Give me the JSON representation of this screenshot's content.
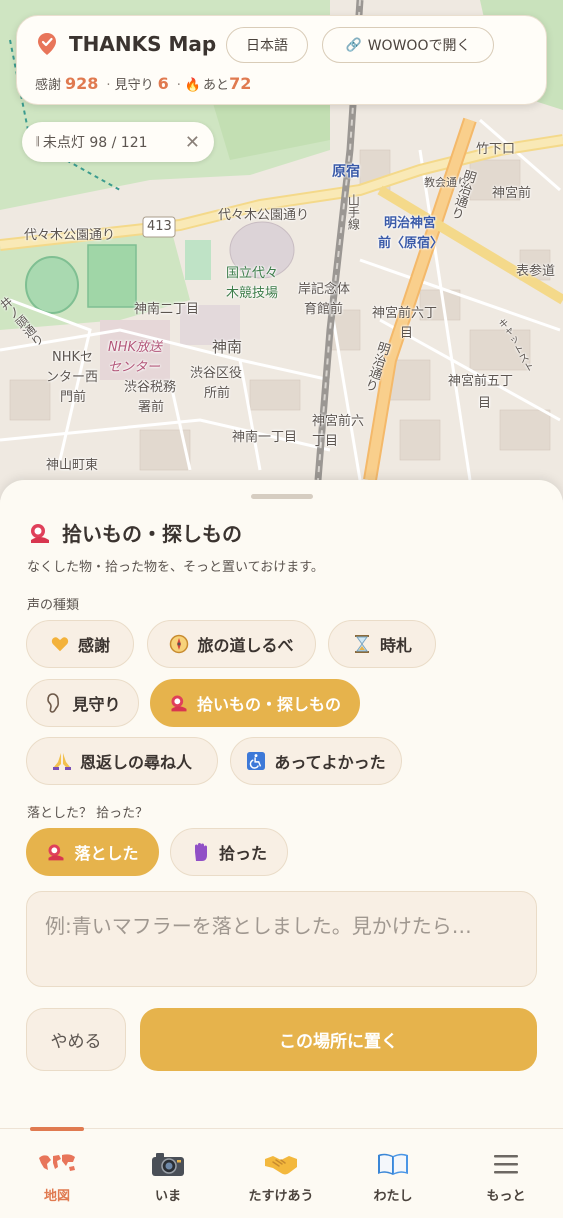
{
  "header": {
    "app_title": "THANKS Map",
    "lang_button": "日本語",
    "wowoo_button": "WOWOOで開く",
    "stats": {
      "thanks_label": "感謝",
      "thanks_count": "928",
      "watch_label": "見守り",
      "watch_count": "6",
      "remaining_label": "あと",
      "remaining_count": "72"
    }
  },
  "filter_chip": {
    "label": "未点灯 98 / 121"
  },
  "map": {
    "road_number": "413",
    "labels": {
      "yoyogi_park_road_1": "代々木公園通り",
      "yoyogi_park_road_2": "代々木公園通り",
      "harajuku": "原宿",
      "takeshita": "竹下口",
      "jingumae": "神宮前",
      "meiji_jingu_mae_1": "明治神宮",
      "meiji_jingu_mae_2": "前〈原宿〉",
      "kyokai_dori": "教会通り",
      "meiji_dori": "明治通り",
      "meiji_dori_2": "明治通り",
      "omotesando": "表参道",
      "stadium_1": "国立代々",
      "stadium_2": "木競技場",
      "kishi_1": "岸記念体",
      "kishi_2": "育館前",
      "jinnan_2": "神南二丁目",
      "jingumae_6_a": "神宮前六丁",
      "jingumae_6_b": "目",
      "jinnan": "神南",
      "nhk_center_1": "NHK放送",
      "nhk_center_2": "センター",
      "nhk_west_1": "NHKセ",
      "nhk_west_2": "ンター西",
      "nhk_west_3": "門前",
      "shibuya_tax_1": "渋谷税務",
      "shibuya_tax_2": "署前",
      "shibuya_ward_1": "渋谷区役",
      "shibuya_ward_2": "所前",
      "jingumae_5_a": "神宮前五丁",
      "jingumae_5_b": "目",
      "jingumae_6_c": "神宮前六",
      "jingumae_6_d": "丁目",
      "jinnan_1": "神南一丁目",
      "kamiyamacho_higashi": "神山町東",
      "inokashira": "井ノ頭通り",
      "yamanote": "山手線",
      "cat_street": "キャットスト"
    }
  },
  "sheet": {
    "title": "拾いもの・探しもの",
    "subtitle": "なくした物・拾った物を、そっと置いておけます。",
    "type_label": "声の種類",
    "types": [
      {
        "label": "感謝",
        "icon": "yellow-heart-icon",
        "selected": false
      },
      {
        "label": "旅の道しるべ",
        "icon": "compass-icon",
        "selected": false
      },
      {
        "label": "時札",
        "icon": "hourglass-icon",
        "selected": false
      },
      {
        "label": "見守り",
        "icon": "ear-icon",
        "selected": false
      },
      {
        "label": "拾いもの・探しもの",
        "icon": "lost-found-icon",
        "selected": true
      },
      {
        "label": "恩返しの尋ね人",
        "icon": "praying-hands-icon",
        "selected": false
      },
      {
        "label": "あってよかった",
        "icon": "wheelchair-icon",
        "selected": false
      }
    ],
    "lost_label": "落とした？ 拾った？",
    "lost_options": [
      {
        "label": "落とした",
        "icon": "lost-found-icon",
        "selected": true
      },
      {
        "label": "拾った",
        "icon": "raised-hand-icon",
        "selected": false
      }
    ],
    "message_placeholder": "例:青いマフラーを落としました。見かけたら…",
    "cancel_button": "やめる",
    "place_button": "この場所に置く"
  },
  "bottom_nav": [
    {
      "label": "地図",
      "icon": "world-map-icon",
      "active": true
    },
    {
      "label": "いま",
      "icon": "camera-icon",
      "active": false
    },
    {
      "label": "たすけあう",
      "icon": "handshake-icon",
      "active": false
    },
    {
      "label": "わたし",
      "icon": "open-book-icon",
      "active": false
    },
    {
      "label": "もっと",
      "icon": "menu-icon",
      "active": false
    }
  ],
  "colors": {
    "accent": "#e6b34c",
    "highlight": "#e07a50",
    "background": "#fdfaf3",
    "chip": "#f8efe4"
  }
}
